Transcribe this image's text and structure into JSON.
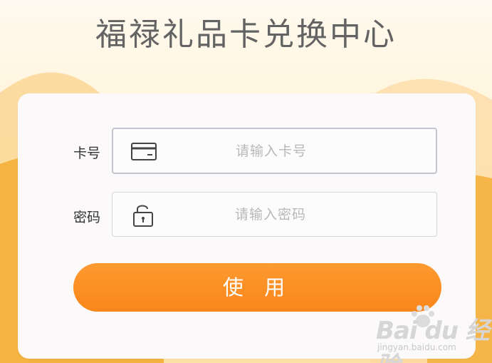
{
  "page": {
    "title": "福禄礼品卡兑换中心"
  },
  "form": {
    "card_label": "卡号",
    "card_placeholder": "请输入卡号",
    "password_label": "密码",
    "password_placeholder": "请输入密码",
    "submit_label": "使 用"
  },
  "watermark": {
    "logo_text": "Bai du 经验",
    "url": "jingyan.baidu.com"
  },
  "icons": {
    "card": "card-icon",
    "lock": "lock-icon",
    "paw": "paw-icon"
  },
  "colors": {
    "accent": "#f98c1f",
    "title": "#636363",
    "placeholder": "#b8b8b8",
    "card_bg": "#fbf9f9"
  }
}
